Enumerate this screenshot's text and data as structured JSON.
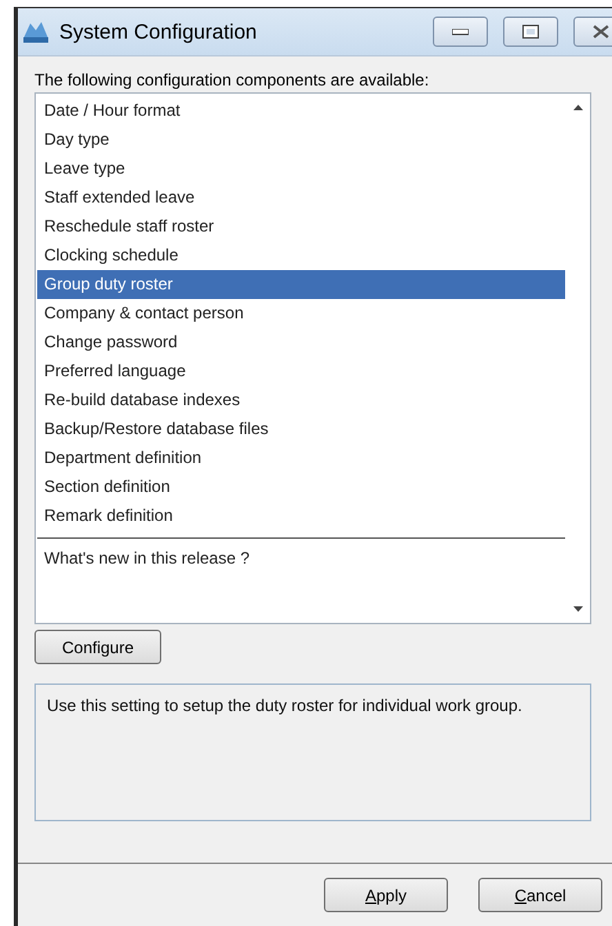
{
  "window": {
    "title": "System Configuration"
  },
  "prompt": "The following configuration components are available:",
  "components": [
    {
      "label": "Date / Hour format",
      "selected": false
    },
    {
      "label": "Day type",
      "selected": false
    },
    {
      "label": "Leave type",
      "selected": false
    },
    {
      "label": "Staff extended leave",
      "selected": false
    },
    {
      "label": "Reschedule staff roster",
      "selected": false
    },
    {
      "label": "Clocking schedule",
      "selected": false
    },
    {
      "label": "Group duty roster",
      "selected": true
    },
    {
      "label": "Company & contact person",
      "selected": false
    },
    {
      "label": "Change password",
      "selected": false
    },
    {
      "label": "Preferred language",
      "selected": false
    },
    {
      "label": "Re-build database indexes",
      "selected": false
    },
    {
      "label": "Backup/Restore database files",
      "selected": false
    },
    {
      "label": "Department definition",
      "selected": false
    },
    {
      "label": "Section definition",
      "selected": false
    },
    {
      "label": "Remark definition",
      "selected": false
    }
  ],
  "footer_item": {
    "label": "What's new in this release ?",
    "selected": false
  },
  "configure_button": "Configure",
  "description": "Use this setting to setup the duty roster for individual work group.",
  "buttons": [
    {
      "label": "Apply",
      "access_key_underlined": true
    },
    {
      "label": "Cancel",
      "access_key_underlined": true
    }
  ]
}
